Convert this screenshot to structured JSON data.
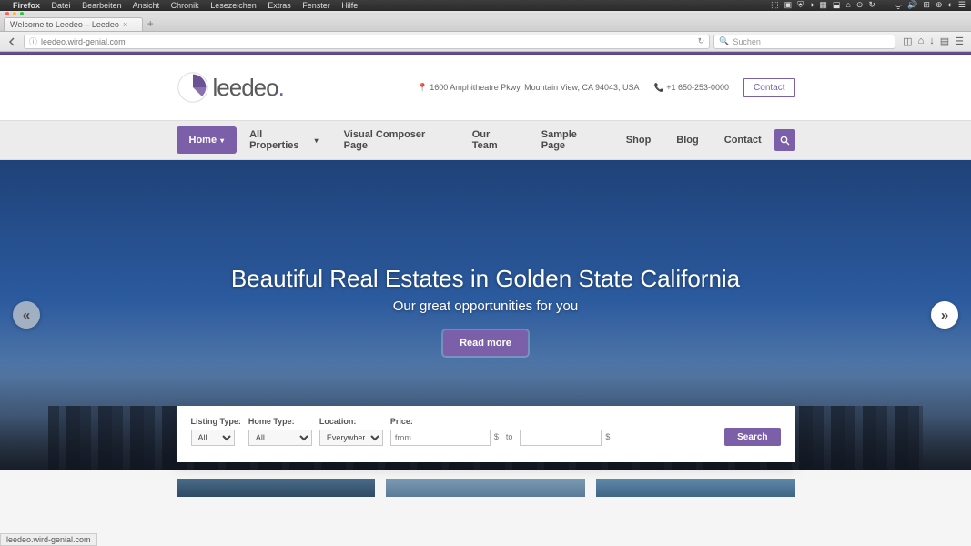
{
  "menubar": {
    "app": "Firefox",
    "items": [
      "Datei",
      "Bearbeiten",
      "Ansicht",
      "Chronik",
      "Lesezeichen",
      "Extras",
      "Fenster",
      "Hilfe"
    ]
  },
  "tab": {
    "title": "Welcome to Leedeo – Leedeo"
  },
  "url": "leedeo.wird-genial.com",
  "search_placeholder": "Suchen",
  "header": {
    "brand": "leedeo",
    "address": "1600 Amphitheatre Pkwy, Mountain View, CA 94043, USA",
    "phone": "+1 650-253-0000",
    "contact_label": "Contact"
  },
  "nav": {
    "items": [
      {
        "label": "Home",
        "dropdown": true,
        "active": true
      },
      {
        "label": "All Properties",
        "dropdown": true
      },
      {
        "label": "Visual Composer Page"
      },
      {
        "label": "Our Team"
      },
      {
        "label": "Sample Page"
      },
      {
        "label": "Shop"
      },
      {
        "label": "Blog"
      },
      {
        "label": "Contact"
      }
    ]
  },
  "hero": {
    "title": "Beautiful Real Estates in Golden State California",
    "subtitle": "Our great opportunities for you",
    "cta": "Read more"
  },
  "filters": {
    "listing_type": {
      "label": "Listing Type:",
      "value": "All"
    },
    "home_type": {
      "label": "Home Type:",
      "value": "All"
    },
    "location": {
      "label": "Location:",
      "value": "Everywhere"
    },
    "price": {
      "label": "Price:",
      "from_placeholder": "from",
      "to_label": "to",
      "currency": "$"
    },
    "search_label": "Search"
  },
  "status": "leedeo.wird-genial.com"
}
